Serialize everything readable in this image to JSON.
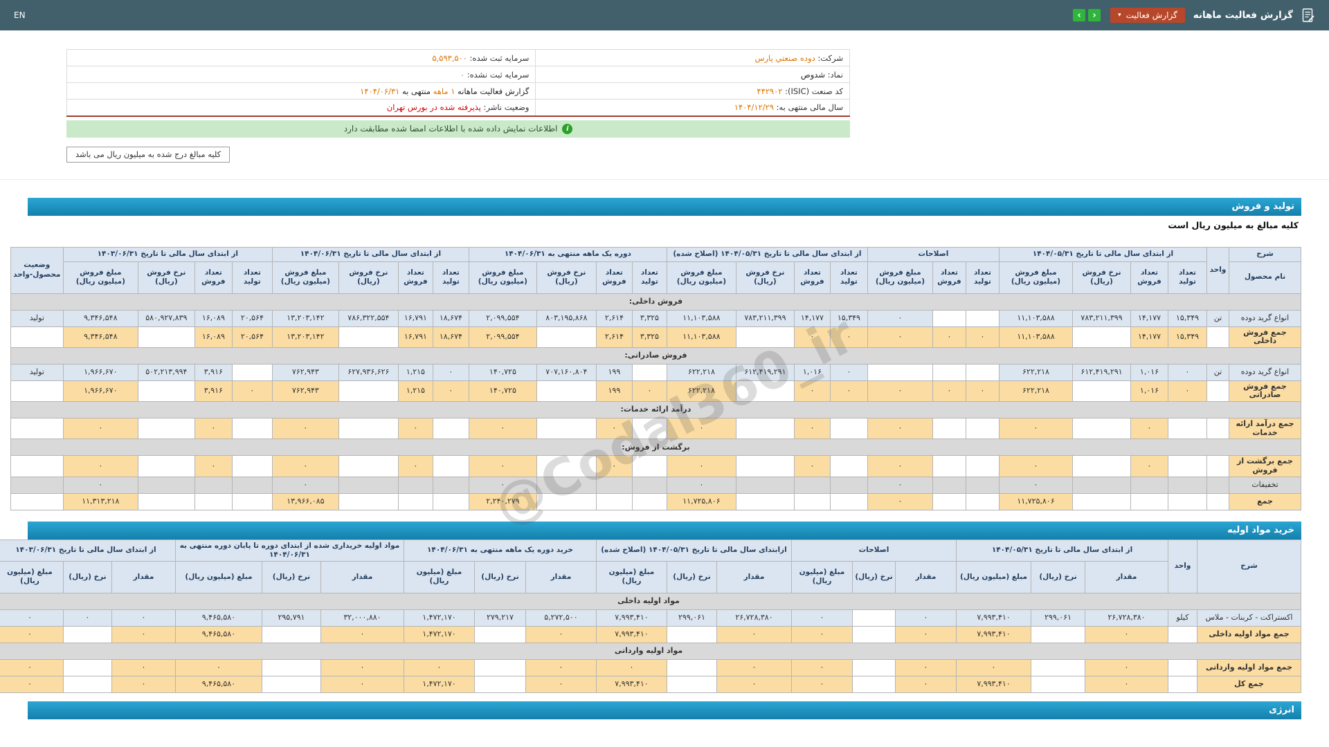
{
  "topbar": {
    "title": "گزارش فعالیت ماهانه",
    "dropdown": "گزارش فعالیت",
    "en": "EN"
  },
  "info": {
    "rows": [
      {
        "right": {
          "label": "شرکت:",
          "value": "دوده صنعتي پارس",
          "style": "orange"
        },
        "left": {
          "label": "سرمایه ثبت شده:",
          "value": "۵,۵۹۳,۵۰۰",
          "style": "orange"
        }
      },
      {
        "right": {
          "label": "نماد:",
          "value": "شدوص",
          "style": "dark"
        },
        "left": {
          "label": "سرمایه ثبت نشده:",
          "value": "۰",
          "style": "orange"
        }
      },
      {
        "right": {
          "label": "کد صنعت (ISIC):",
          "value": "۴۴۲۹۰۲",
          "style": "orange"
        },
        "left": {
          "parts": [
            {
              "t": "گزارش فعالیت ماهانه ",
              "c": "dark"
            },
            {
              "t": "۱ ماهه",
              "c": "orange"
            },
            {
              "t": " منتهی به ",
              "c": "dark"
            },
            {
              "t": "۱۴۰۴/۰۶/۳۱",
              "c": "orange"
            }
          ]
        }
      },
      {
        "right": {
          "label": "سال مالی منتهی به:",
          "value": "۱۴۰۴/۱۲/۲۹",
          "style": "orange"
        },
        "left": {
          "label": "وضعیت ناشر:",
          "value": "پذیرفته شده در بورس تهران",
          "style": "red"
        }
      }
    ],
    "signed_notice": "اطلاعات نمایش داده شده با اطلاعات امضا شده مطابقت دارد",
    "million_note": "کلیه مبالغ درج شده به میلیون ریال می باشد"
  },
  "watermark": "@Codal360_ir",
  "sales": {
    "section_title": "تولید و فروش",
    "subtitle": "کلیه مبالغ به میلیون ریال است",
    "header": {
      "desc_top": "شرح",
      "desc_bottom": "نام محصول",
      "unit": "واحد",
      "status": "وضعیت محصول-واحد",
      "groups": [
        {
          "title": "از ابتدای سال مالی تا تاریخ ۱۴۰۴/۰۵/۳۱",
          "cols": [
            "تعداد تولید",
            "تعداد فروش",
            "نرخ فروش (ریال)",
            "مبلغ فروش (میلیون ریال)"
          ]
        },
        {
          "title": "اصلاحات",
          "cols": [
            "تعداد تولید",
            "تعداد فروش",
            "مبلغ فروش (میلیون ریال)"
          ]
        },
        {
          "title": "از ابتدای سال مالی تا تاریخ ۱۴۰۴/۰۵/۳۱ (اصلاح شده)",
          "cols": [
            "تعداد تولید",
            "تعداد فروش",
            "نرخ فروش (ریال)",
            "مبلغ فروش (میلیون ریال)"
          ]
        },
        {
          "title": "دوره یک ماهه منتهی به ۱۴۰۴/۰۶/۳۱",
          "cols": [
            "تعداد تولید",
            "تعداد فروش",
            "نرخ فروش (ریال)",
            "مبلغ فروش (میلیون ریال)"
          ]
        },
        {
          "title": "از ابتدای سال مالی تا تاریخ ۱۴۰۴/۰۶/۳۱",
          "cols": [
            "تعداد تولید",
            "تعداد فروش",
            "نرخ فروش (ریال)",
            "مبلغ فروش (میلیون ریال)"
          ]
        },
        {
          "title": "از ابتدای سال مالی تا تاریخ ۱۴۰۳/۰۶/۳۱",
          "cols": [
            "تعداد تولید",
            "تعداد فروش",
            "نرخ فروش (ریال)",
            "مبلغ فروش (میلیون ریال)"
          ]
        }
      ]
    },
    "rows": [
      {
        "type": "section",
        "name": "فروش داخلی:"
      },
      {
        "type": "product",
        "name": "انواع گرید دوده",
        "unit": "تن",
        "status": "تولید",
        "cells": [
          "۱۵,۳۴۹",
          "۱۴,۱۷۷",
          "۷۸۳,۲۱۱,۳۹۹",
          "۱۱,۱۰۳,۵۸۸",
          "",
          "",
          "۰",
          "۱۵,۳۴۹",
          "۱۴,۱۷۷",
          "۷۸۳,۲۱۱,۳۹۹",
          "۱۱,۱۰۳,۵۸۸",
          "۳,۳۲۵",
          "۲,۶۱۴",
          "۸۰۳,۱۹۵,۸۶۸",
          "۲,۰۹۹,۵۵۴",
          "۱۸,۶۷۴",
          "۱۶,۷۹۱",
          "۷۸۶,۳۲۲,۵۵۴",
          "۱۳,۲۰۳,۱۴۲",
          "۲۰,۵۶۴",
          "۱۶,۰۸۹",
          "۵۸۰,۹۲۷,۸۳۹",
          "۹,۳۴۶,۵۴۸"
        ]
      },
      {
        "type": "total",
        "name": "جمع فروش داخلی",
        "unit": "",
        "status": "",
        "cells": [
          "۱۵,۳۴۹",
          "۱۴,۱۷۷",
          "",
          "۱۱,۱۰۳,۵۸۸",
          "۰",
          "۰",
          "۰",
          "۰",
          "۰",
          "",
          "۱۱,۱۰۳,۵۸۸",
          "۳,۳۲۵",
          "۲,۶۱۴",
          "",
          "۲,۰۹۹,۵۵۴",
          "۱۸,۶۷۴",
          "۱۶,۷۹۱",
          "",
          "۱۳,۲۰۳,۱۴۲",
          "۲۰,۵۶۴",
          "۱۶,۰۸۹",
          "",
          "۹,۳۴۶,۵۴۸"
        ]
      },
      {
        "type": "section",
        "name": "فروش صادراتی:"
      },
      {
        "type": "product",
        "name": "انواع گرید دوده",
        "unit": "تن",
        "status": "تولید",
        "cells": [
          "۰",
          "۱,۰۱۶",
          "۶۱۲,۴۱۹,۲۹۱",
          "۶۲۲,۲۱۸",
          "",
          "",
          "",
          "۰",
          "۱,۰۱۶",
          "۶۱۲,۴۱۹,۲۹۱",
          "۶۲۲,۲۱۸",
          "",
          "۱۹۹",
          "۷۰۷,۱۶۰,۸۰۴",
          "۱۴۰,۷۲۵",
          "۰",
          "۱,۲۱۵",
          "۶۲۷,۹۳۶,۶۲۶",
          "۷۶۲,۹۴۳",
          "",
          "۳,۹۱۶",
          "۵۰۲,۲۱۳,۹۹۴",
          "۱,۹۶۶,۶۷۰"
        ]
      },
      {
        "type": "total",
        "name": "جمع فروش صادراتی",
        "unit": "",
        "status": "",
        "cells": [
          "۰",
          "۱,۰۱۶",
          "",
          "۶۲۲,۲۱۸",
          "۰",
          "۰",
          "۰",
          "۰",
          "۰",
          "",
          "۶۲۲,۲۱۸",
          "۰",
          "۱۹۹",
          "",
          "۱۴۰,۷۲۵",
          "۰",
          "۱,۲۱۵",
          "",
          "۷۶۲,۹۴۳",
          "۰",
          "۳,۹۱۶",
          "",
          "۱,۹۶۶,۶۷۰"
        ]
      },
      {
        "type": "section",
        "name": "درآمد ارائه خدمات:"
      },
      {
        "type": "total",
        "name": "جمع درآمد ارائه خدمات",
        "unit": "",
        "status": "",
        "cells": [
          "",
          "۰",
          "",
          "۰",
          "",
          "",
          "۰",
          "",
          "۰",
          "",
          "۰",
          "",
          "۰",
          "",
          "۰",
          "",
          "۰",
          "",
          "۰",
          "",
          "۰",
          "",
          "۰"
        ]
      },
      {
        "type": "section",
        "name": "برگشت از فروش:"
      },
      {
        "type": "total",
        "name": "جمع برگشت از فروش",
        "unit": "",
        "status": "",
        "cells": [
          "",
          "۰",
          "",
          "۰",
          "",
          "",
          "۰",
          "",
          "۰",
          "",
          "۰",
          "",
          "۰",
          "",
          "۰",
          "",
          "۰",
          "",
          "۰",
          "",
          "۰",
          "",
          "۰"
        ]
      },
      {
        "type": "muted",
        "name": "تخفیفات",
        "unit": "",
        "status": "",
        "cells": [
          "",
          "",
          "",
          "۰",
          "",
          "",
          "۰",
          "",
          "",
          "",
          "۰",
          "",
          "",
          "",
          "۰",
          "",
          "",
          "",
          "۰",
          "",
          "",
          "",
          "۰"
        ]
      },
      {
        "type": "total",
        "name": "جمع",
        "unit": "",
        "status": "",
        "cells": [
          "",
          "",
          "",
          "۱۱,۷۲۵,۸۰۶",
          "",
          "",
          "۰",
          "",
          "",
          "",
          "۱۱,۷۲۵,۸۰۶",
          "",
          "",
          "",
          "۲,۲۴۰,۲۷۹",
          "",
          "",
          "",
          "۱۳,۹۶۶,۰۸۵",
          "",
          "",
          "",
          "۱۱,۳۱۳,۲۱۸"
        ]
      }
    ]
  },
  "materials": {
    "section_title": "خرید مواد اولیه",
    "header": {
      "desc_top": "شرح",
      "unit": "واحد",
      "groups": [
        {
          "title": "از ابتدای سال مالی تا تاریخ ۱۴۰۴/۰۵/۳۱",
          "cols": [
            "مقدار",
            "نرخ (ریال)",
            "مبلغ (میلیون ریال)"
          ]
        },
        {
          "title": "اصلاحات",
          "cols": [
            "مقدار",
            "نرخ (ریال)",
            "مبلغ (میلیون ریال)"
          ]
        },
        {
          "title": "ازابتدای سال مالی تا تاریخ ۱۴۰۴/۰۵/۳۱ (اصلاح شده)",
          "cols": [
            "مقدار",
            "نرخ (ریال)",
            "مبلغ (میلیون ریال)"
          ]
        },
        {
          "title": "خرید دوره یک ماهه منتهی به ۱۴۰۴/۰۶/۳۱",
          "cols": [
            "مقدار",
            "نرخ (ریال)",
            "مبلغ (میلیون ریال)"
          ]
        },
        {
          "title": "مواد اولیه خریداری شده از ابتدای دوره تا پایان دوره منتهی به ۱۴۰۴/۰۶/۳۱",
          "cols": [
            "مقدار",
            "نرخ (ریال)",
            "مبلغ (میلیون ریال)"
          ]
        },
        {
          "title": "از ابتدای سال مالی تا تاریخ ۱۴۰۳/۰۶/۳۱",
          "cols": [
            "مقدار",
            "نرخ (ریال)",
            "مبلغ (میلیون ریال)"
          ]
        }
      ]
    },
    "rows": [
      {
        "type": "section",
        "name": "مواد اولیه داخلی"
      },
      {
        "type": "product",
        "name": "اکستراکت - کربنات - ملاس",
        "unit": "کیلو",
        "cells": [
          "۲۶,۷۲۸,۳۸۰",
          "۲۹۹,۰۶۱",
          "۷,۹۹۳,۴۱۰",
          "۰",
          "",
          "۰",
          "۲۶,۷۲۸,۳۸۰",
          "۲۹۹,۰۶۱",
          "۷,۹۹۳,۴۱۰",
          "۵,۲۷۲,۵۰۰",
          "۲۷۹,۲۱۷",
          "۱,۴۷۲,۱۷۰",
          "۳۲,۰۰۰,۸۸۰",
          "۲۹۵,۷۹۱",
          "۹,۴۶۵,۵۸۰",
          "۰",
          "۰",
          "۰"
        ]
      },
      {
        "type": "total",
        "name": "جمع مواد اولیه داخلی",
        "unit": "",
        "cells": [
          "۰",
          "",
          "۷,۹۹۳,۴۱۰",
          "۰",
          "",
          "۰",
          "۰",
          "",
          "۷,۹۹۳,۴۱۰",
          "۰",
          "",
          "۱,۴۷۲,۱۷۰",
          "۰",
          "",
          "۹,۴۶۵,۵۸۰",
          "۰",
          "",
          "۰"
        ]
      },
      {
        "type": "section",
        "name": "مواد اولیه وارداتی"
      },
      {
        "type": "total",
        "name": "جمع مواد اولیه وارداتی",
        "unit": "",
        "cells": [
          "۰",
          "",
          "۰",
          "۰",
          "",
          "۰",
          "۰",
          "",
          "۰",
          "۰",
          "",
          "۰",
          "۰",
          "",
          "۰",
          "۰",
          "",
          "۰"
        ]
      },
      {
        "type": "total",
        "name": "جمع کل",
        "unit": "",
        "cells": [
          "۰",
          "",
          "۷,۹۹۳,۴۱۰",
          "۰",
          "",
          "۰",
          "۰",
          "",
          "۷,۹۹۳,۴۱۰",
          "۰",
          "",
          "۱,۴۷۲,۱۷۰",
          "۰",
          "",
          "۹,۴۶۵,۵۸۰",
          "۰",
          "",
          "۰"
        ]
      }
    ]
  },
  "energy": {
    "section_title": "انرژی"
  }
}
